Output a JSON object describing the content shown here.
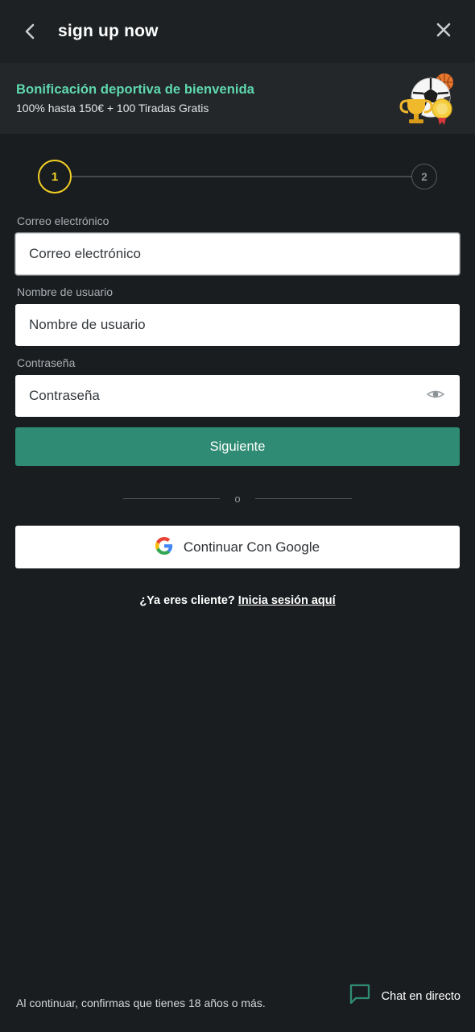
{
  "header": {
    "title": "sign up now",
    "back_icon": "chevron-left-icon",
    "close_icon": "close-icon"
  },
  "banner": {
    "title": "Bonificación deportiva de bienvenida",
    "subtitle": "100% hasta 150€ + 100 Tiradas Gratis",
    "art_icon": "sports-trophy-ball-icon"
  },
  "stepper": {
    "steps": [
      {
        "label": "1",
        "state": "active"
      },
      {
        "label": "2",
        "state": "inactive"
      }
    ]
  },
  "form": {
    "fields": [
      {
        "label": "Correo electrónico",
        "placeholder": "Correo electrónico",
        "value": "",
        "focused": true
      },
      {
        "label": "Nombre de usuario",
        "placeholder": "Nombre de usuario",
        "value": "",
        "focused": false
      },
      {
        "label": "Contraseña",
        "placeholder": "Contraseña",
        "value": "",
        "focused": false,
        "toggle_icon": "eye-icon"
      }
    ],
    "submit_label": "Siguiente"
  },
  "divider": {
    "text": "o"
  },
  "social": {
    "google_label": "Continuar Con Google",
    "google_icon": "google-g-icon"
  },
  "login_prompt": {
    "question": "¿Ya eres cliente?",
    "link": "Inicia sesión aquí"
  },
  "footer": {
    "age_notice": "Al continuar, confirmas que tienes 18 años o más.",
    "chat_label": "Chat en directo",
    "chat_icon": "chat-bubble-icon"
  },
  "colors": {
    "page_bg": "#1a1d1f",
    "header_bg": "#1e2123",
    "banner_bg": "#23272a",
    "banner_title": "#5fd9ae",
    "accent_green": "#2f8b73",
    "step_active": "#f2d024",
    "step_inactive": "#8b9094",
    "chat_green": "#2f8b73"
  }
}
